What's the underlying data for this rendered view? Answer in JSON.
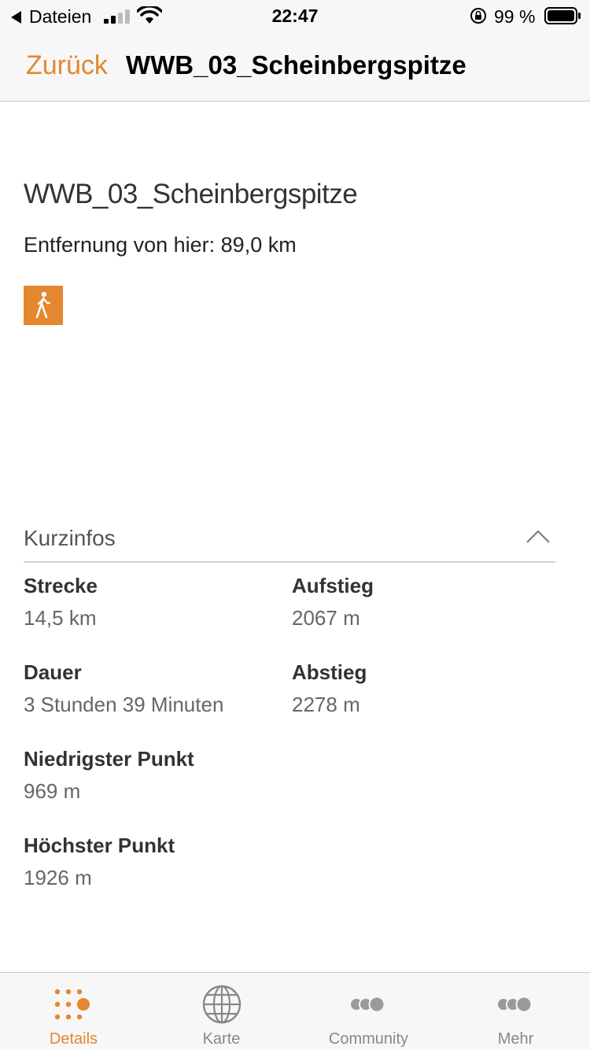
{
  "status_bar": {
    "back_app": "Dateien",
    "time": "22:47",
    "battery": "99 %"
  },
  "nav": {
    "back_label": "Zurück",
    "title": "WWB_03_Scheinbergspitze"
  },
  "tour": {
    "title": "WWB_03_Scheinbergspitze",
    "distance": "Entfernung von hier: 89,0 km",
    "activity_icon": "hiking-icon"
  },
  "kurzinfos": {
    "title": "Kurzinfos",
    "items": [
      {
        "label": "Strecke",
        "value": "14,5 km"
      },
      {
        "label": "Aufstieg",
        "value": "2067 m"
      },
      {
        "label": "Dauer",
        "value": "3 Stunden 39 Minuten"
      },
      {
        "label": "Abstieg",
        "value": "2278 m"
      },
      {
        "label": "Niedrigster Punkt",
        "value": "969 m"
      },
      {
        "label": "Höchster Punkt",
        "value": "1926 m"
      }
    ]
  },
  "tabs": [
    {
      "label": "Details",
      "icon": "details-dots-icon",
      "active": true
    },
    {
      "label": "Karte",
      "icon": "globe-icon",
      "active": false
    },
    {
      "label": "Community",
      "icon": "community-icon",
      "active": false
    },
    {
      "label": "Mehr",
      "icon": "more-icon",
      "active": false
    }
  ],
  "colors": {
    "accent": "#e4872f",
    "bar_background": "#f7f7f7",
    "inactive": "#888888"
  }
}
